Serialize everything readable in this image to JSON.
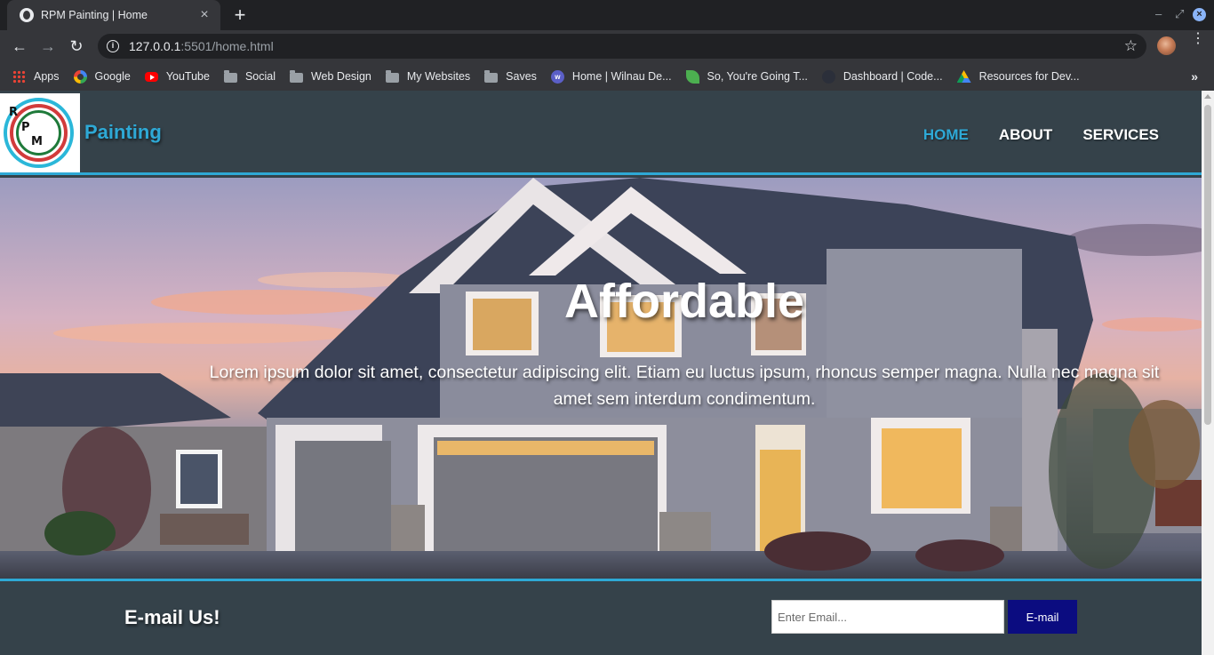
{
  "browser": {
    "tab": {
      "title": "RPM Painting | Home",
      "favicon": "globe-icon",
      "close": "×"
    },
    "new_tab": "+",
    "window_controls": {
      "minimize": "–",
      "restore": "⤢",
      "close": "×"
    },
    "nav": {
      "back": "←",
      "forward": "→",
      "reload": "↻"
    },
    "url": {
      "host": "127.0.0.1",
      "path": ":5501/home.html"
    },
    "bookmark_star": "☆",
    "bookmarks": [
      {
        "label": "Apps",
        "icon": "apps-grid-icon"
      },
      {
        "label": "Google",
        "icon": "google-icon"
      },
      {
        "label": "YouTube",
        "icon": "youtube-icon"
      },
      {
        "label": "Social",
        "icon": "folder-icon"
      },
      {
        "label": "Web Design",
        "icon": "folder-icon"
      },
      {
        "label": "My Websites",
        "icon": "folder-icon"
      },
      {
        "label": "Saves",
        "icon": "folder-icon"
      },
      {
        "label": "Home | Wilnau De...",
        "icon": "w-site-icon"
      },
      {
        "label": "So, You're Going T...",
        "icon": "leaf-icon"
      },
      {
        "label": "Dashboard | Code...",
        "icon": "code-site-icon"
      },
      {
        "label": "Resources for Dev...",
        "icon": "google-drive-icon"
      }
    ],
    "bookmarks_overflow": "»"
  },
  "site": {
    "logo_letters": [
      "R",
      "P",
      "M"
    ],
    "brand": "Painting",
    "nav": [
      {
        "label": "Home",
        "active": true
      },
      {
        "label": "About",
        "active": false
      },
      {
        "label": "Services",
        "active": false
      }
    ],
    "hero": {
      "title": "Affordable",
      "text": "Lorem ipsum dolor sit amet, consectetur adipiscing elit. Etiam eu luctus ipsum, rhoncus semper magna. Nulla nec magna sit amet sem interdum condimentum."
    },
    "newsletter": {
      "title": "E-mail Us!",
      "input_placeholder": "Enter Email...",
      "button_label": "E-mail"
    }
  },
  "colors": {
    "header_bg": "#35424a",
    "accent": "#2ea9d6",
    "button_bg": "#0b0c80"
  }
}
